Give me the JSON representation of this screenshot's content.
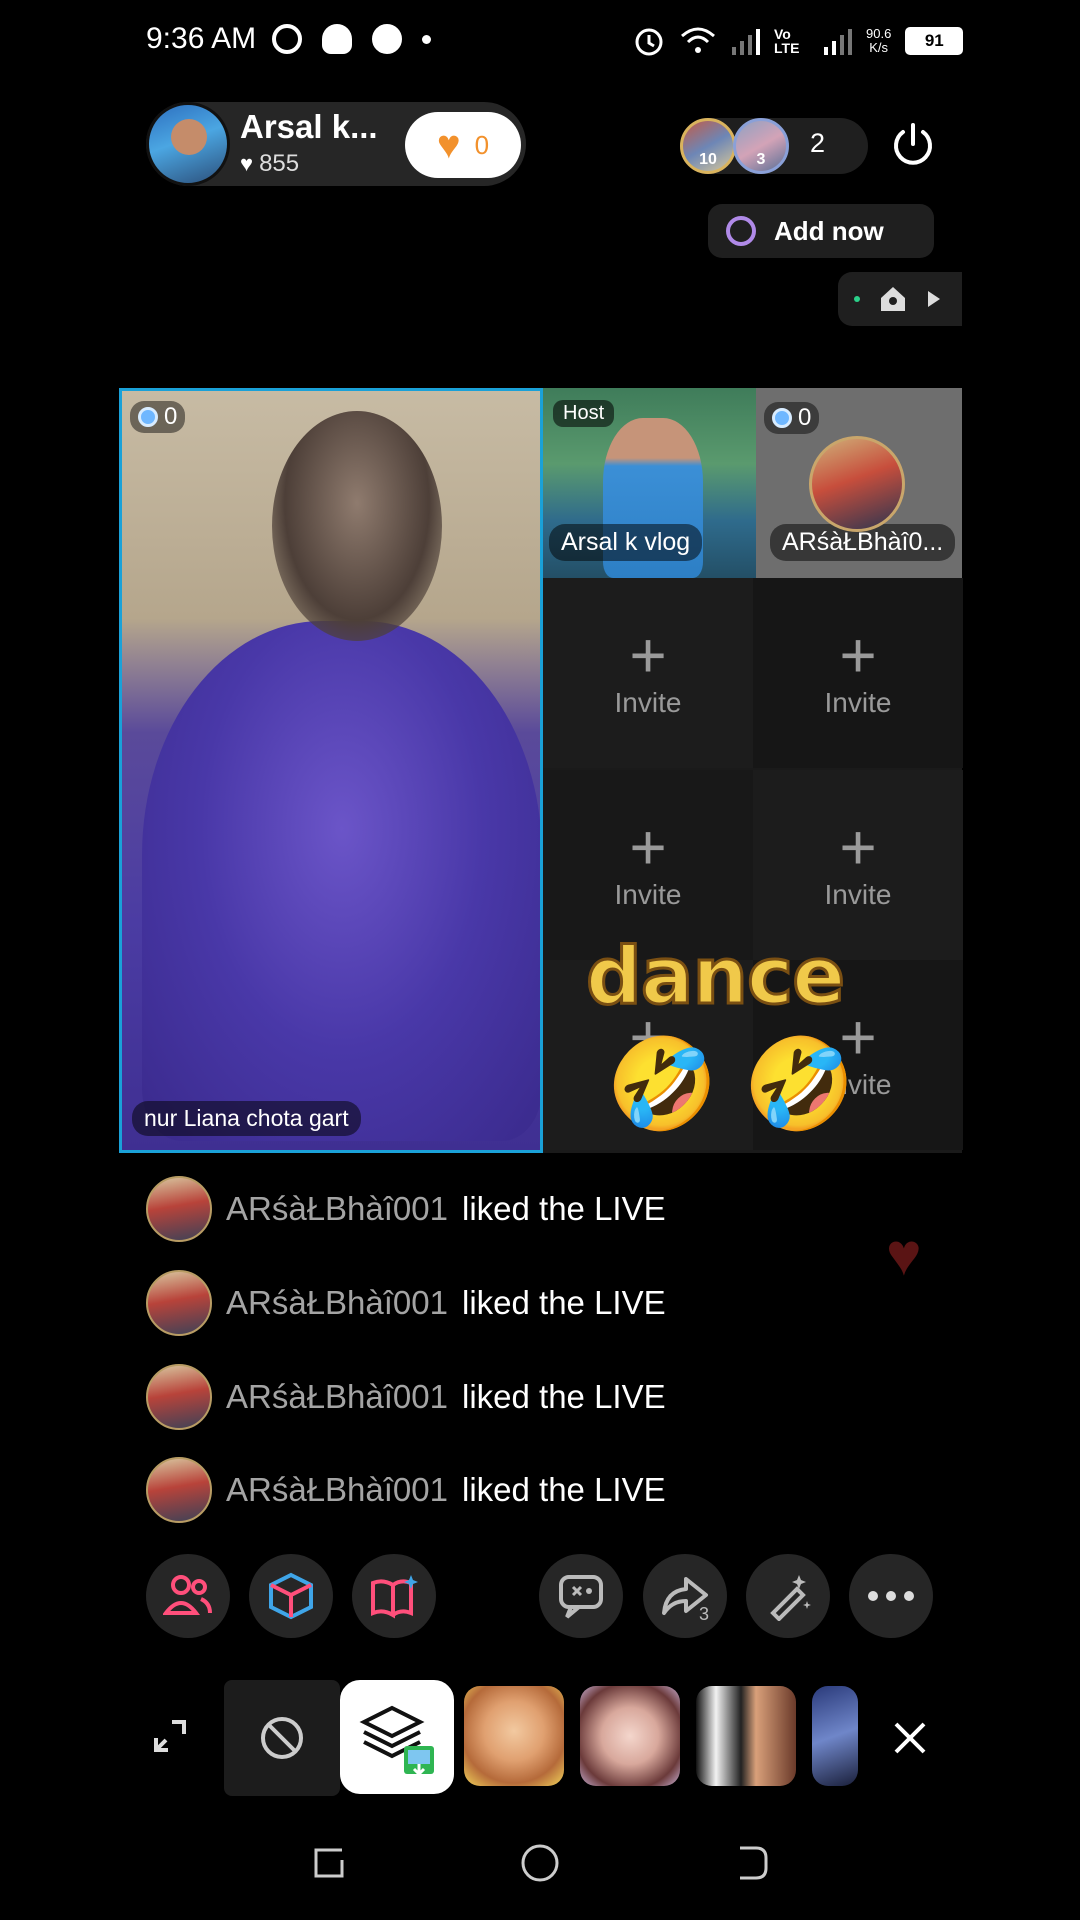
{
  "status_bar": {
    "time": "9:36 AM",
    "network": "Vo LTE",
    "speed_value": "90.6",
    "speed_unit": "K/s",
    "battery": "91"
  },
  "host": {
    "name": "Arsal k...",
    "likes": "855",
    "follow_count": "0"
  },
  "viewers": {
    "badge1": "10",
    "badge2": "3",
    "count": "2"
  },
  "add_now_label": "Add now",
  "grid": {
    "main_cam_score": "0",
    "main_cam_name": "nur Liana chota gart",
    "host_tag": "Host",
    "host_cell_name": "Arsal k vlog",
    "guest_score": "0",
    "guest_name": "ARśàŁBhàî0...",
    "invite_label": "Invite",
    "overlay_text": "dance",
    "overlay_emoji": "🤣 🤣"
  },
  "comments": [
    {
      "user": "ARśàŁBhàî001",
      "text": "liked the LIVE"
    },
    {
      "user": "ARśàŁBhàî001",
      "text": "liked the LIVE"
    },
    {
      "user": "ARśàŁBhàî001",
      "text": "liked the LIVE"
    },
    {
      "user": "ARśàŁBhàî001",
      "text": "liked the LIVE"
    }
  ],
  "actions": {
    "share_count": "3",
    "icons": [
      "guests-icon",
      "cube-icon",
      "book-sparkle-icon",
      "chat-off-icon",
      "share-icon",
      "magic-wand-icon",
      "more-icon"
    ]
  },
  "colors": {
    "accent_pink": "#ff4f7b",
    "accent_blue": "#3fa5e8",
    "follow_orange": "#f2912c",
    "selected_border": "#1aa1d8"
  }
}
